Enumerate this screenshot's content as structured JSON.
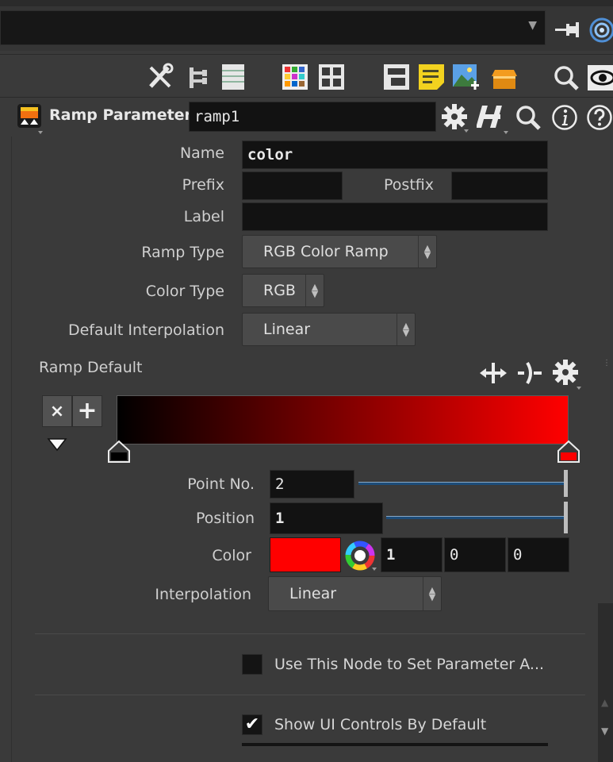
{
  "header": {
    "node_type": "Ramp Parameter",
    "node_name": "ramp1"
  },
  "form": {
    "name_label": "Name",
    "name_value": "color",
    "prefix_label": "Prefix",
    "prefix_value": "",
    "postfix_label": "Postfix",
    "postfix_value": "",
    "label_label": "Label",
    "label_value": "",
    "ramp_type_label": "Ramp Type",
    "ramp_type_value": "RGB Color Ramp",
    "color_type_label": "Color Type",
    "color_type_value": "RGB",
    "default_interp_label": "Default Interpolation",
    "default_interp_value": "Linear"
  },
  "ramp": {
    "section_label": "Ramp Default",
    "remove_glyph": "×",
    "add_glyph": "+",
    "gradient_start": "#000000",
    "gradient_end": "#ff0000",
    "point_no_label": "Point No.",
    "point_no_value": "2",
    "position_label": "Position",
    "position_value": "1",
    "color_label": "Color",
    "color_swatch": "#ff0000",
    "color_r": "1",
    "color_g": "0",
    "color_b": "0",
    "interp_label": "Interpolation",
    "interp_value": "Linear"
  },
  "options": {
    "use_node_label": "Use This Node to Set Parameter A...",
    "use_node_checked": false,
    "show_ui_label": "Show UI Controls By Default",
    "show_ui_checked": true
  }
}
